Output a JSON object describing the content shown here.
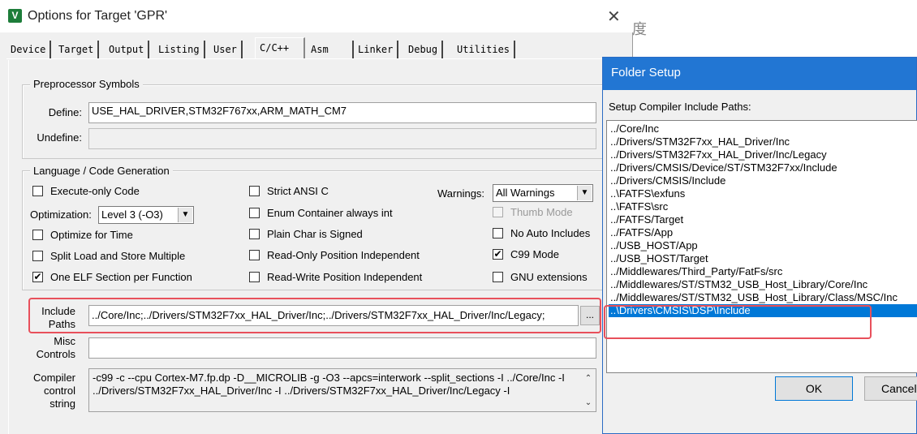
{
  "background": {
    "glyph": "度"
  },
  "window": {
    "title": "Options for Target 'GPR'",
    "close_glyph": "✕",
    "app_icon_glyph": "V"
  },
  "tabs": [
    {
      "label": "Device"
    },
    {
      "label": "Target"
    },
    {
      "label": "Output"
    },
    {
      "label": "Listing"
    },
    {
      "label": "User"
    },
    {
      "label": "C/C++"
    },
    {
      "label": "Asm"
    },
    {
      "label": "Linker"
    },
    {
      "label": "Debug"
    },
    {
      "label": "Utilities"
    }
  ],
  "active_tab": "C/C++",
  "preprocessor": {
    "group_label": "Preprocessor Symbols",
    "define_label": "Define:",
    "define_value": "USE_HAL_DRIVER,STM32F767xx,ARM_MATH_CM7",
    "undefine_label": "Undefine:",
    "undefine_value": ""
  },
  "language": {
    "group_label": "Language / Code Generation",
    "execute_only": {
      "label": "Execute-only Code",
      "checked": ""
    },
    "optimization_label": "Optimization:",
    "optimization_value": "Level 3 (-O3)",
    "optimize_time": {
      "label": "Optimize for Time",
      "checked": ""
    },
    "split_load": {
      "label": "Split Load and Store Multiple",
      "checked": ""
    },
    "one_elf": {
      "label": "One ELF Section per Function",
      "checked": "✔"
    },
    "strict_ansi": {
      "label": "Strict ANSI C",
      "checked": ""
    },
    "enum_container": {
      "label": "Enum Container always int",
      "checked": ""
    },
    "plain_char": {
      "label": "Plain Char is Signed",
      "checked": ""
    },
    "ro_position": {
      "label": "Read-Only Position Independent",
      "checked": ""
    },
    "rw_position": {
      "label": "Read-Write Position Independent",
      "checked": ""
    },
    "warnings_label": "Warnings:",
    "warnings_value": "All Warnings",
    "thumb_mode": {
      "label": "Thumb Mode",
      "checked": ""
    },
    "no_auto_includes": {
      "label": "No Auto Includes",
      "checked": ""
    },
    "c99_mode": {
      "label": "C99 Mode",
      "checked": "✔"
    },
    "gnu_extensions": {
      "label": "GNU extensions",
      "checked": ""
    }
  },
  "include_paths": {
    "label_line1": "Include",
    "label_line2": "Paths",
    "value": "../Core/Inc;../Drivers/STM32F7xx_HAL_Driver/Inc;../Drivers/STM32F7xx_HAL_Driver/Inc/Legacy;",
    "browse_label": "..."
  },
  "misc": {
    "label_line1": "Misc",
    "label_line2": "Controls",
    "value": ""
  },
  "compiler_control": {
    "label_line1": "Compiler",
    "label_line2": "control",
    "label_line3": "string",
    "line1": "-c99 -c --cpu Cortex-M7.fp.dp -D__MICROLIB -g -O3 --apcs=interwork --split_sections -I ../Core/Inc -I",
    "line2": "../Drivers/STM32F7xx_HAL_Driver/Inc -I ../Drivers/STM32F7xx_HAL_Driver/Inc/Legacy -I",
    "scroll_up": "⌃",
    "scroll_down": "⌄"
  },
  "folder_setup": {
    "title": "Folder Setup",
    "label": "Setup Compiler Include Paths:",
    "items": [
      "../Core/Inc",
      "../Drivers/STM32F7xx_HAL_Driver/Inc",
      "../Drivers/STM32F7xx_HAL_Driver/Inc/Legacy",
      "../Drivers/CMSIS/Device/ST/STM32F7xx/Include",
      "../Drivers/CMSIS/Include",
      "..\\FATFS\\exfuns",
      "..\\FATFS\\src",
      "../FATFS/Target",
      "../FATFS/App",
      "../USB_HOST/App",
      "../USB_HOST/Target",
      "../Middlewares/Third_Party/FatFs/src",
      "../Middlewares/ST/STM32_USB_Host_Library/Core/Inc",
      "../Middlewares/ST/STM32_USB_Host_Library/Class/MSC/Inc",
      "..\\Drivers\\CMSIS\\DSP\\Include"
    ],
    "selected_index": 14,
    "ok_label": "OK",
    "cancel_label": "Cancel"
  },
  "colors": {
    "highlight_box": "#e8505b",
    "selection": "#0078d7",
    "folder_titlebar": "#2276d3"
  }
}
